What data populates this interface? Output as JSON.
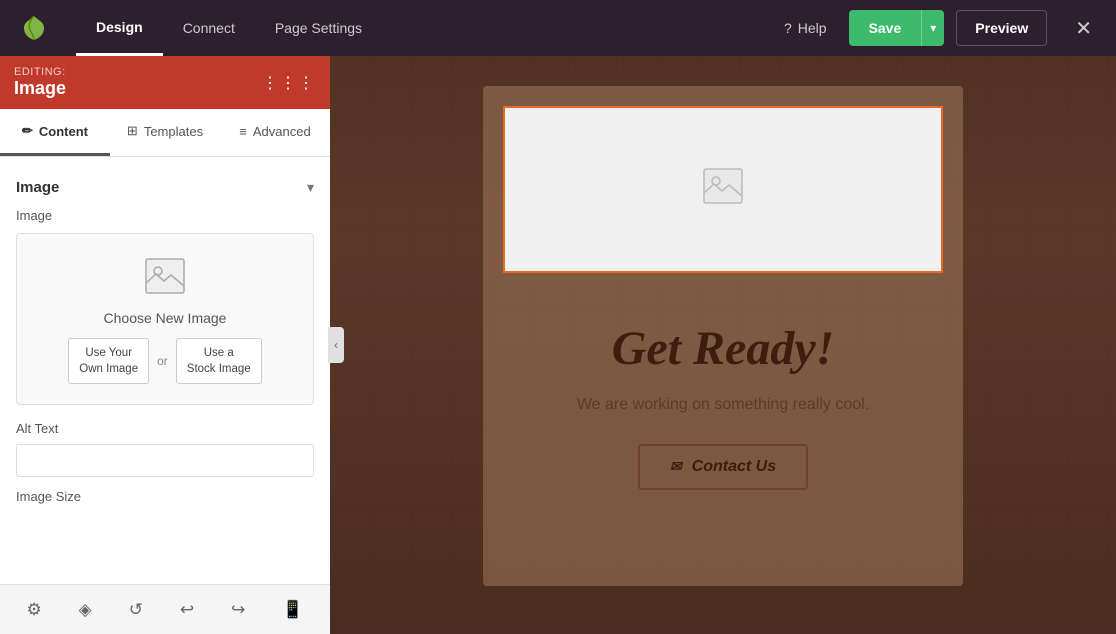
{
  "topbar": {
    "nav_items": [
      {
        "label": "Design",
        "active": true
      },
      {
        "label": "Connect",
        "active": false
      },
      {
        "label": "Page Settings",
        "active": false
      }
    ],
    "help_label": "Help",
    "save_label": "Save",
    "preview_label": "Preview"
  },
  "sidebar": {
    "editing_label": "EDITING:",
    "editing_title": "Image",
    "tabs": [
      {
        "label": "Content",
        "icon": "✏️",
        "active": true
      },
      {
        "label": "Templates",
        "icon": "🎨",
        "active": false
      },
      {
        "label": "Advanced",
        "icon": "⚙️",
        "active": false
      }
    ],
    "section_title": "Image",
    "image_label": "Image",
    "choose_image_text": "Choose New Image",
    "use_own_label": "Use Your\nOwn Image",
    "or_label": "or",
    "stock_label": "Use a\nStock Image",
    "alt_text_label": "Alt Text",
    "alt_text_placeholder": "",
    "image_size_label": "Image Size"
  },
  "canvas": {
    "get_ready_text": "Get Ready!",
    "subtitle_text": "We are working on something really cool.",
    "contact_btn_label": "Contact Us"
  },
  "bottom_toolbar": {
    "icons": [
      "settings-icon",
      "layers-icon",
      "history-icon",
      "undo-icon",
      "redo-icon",
      "mobile-icon"
    ]
  }
}
